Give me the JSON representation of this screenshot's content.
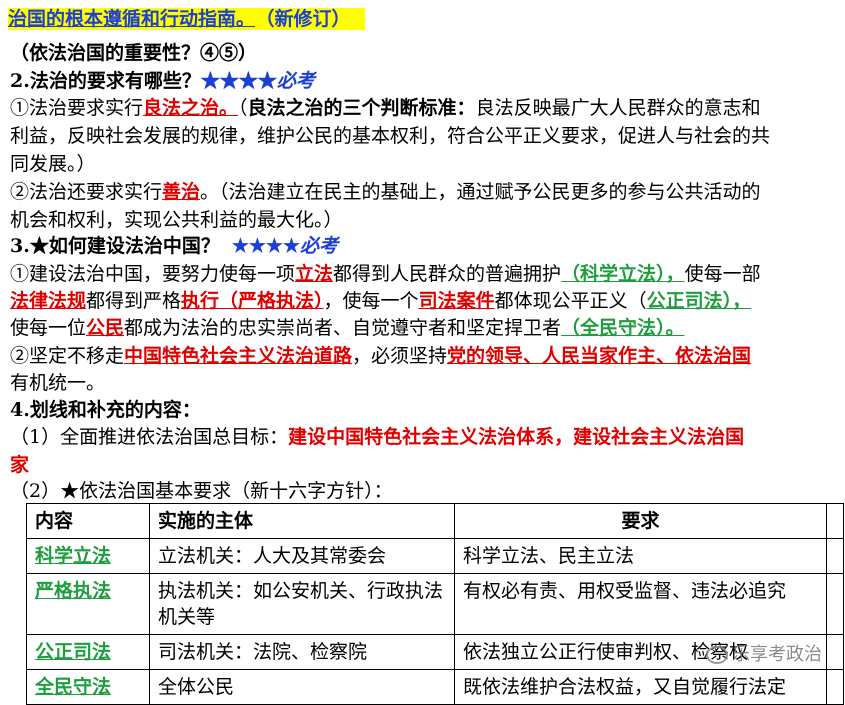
{
  "title": {
    "main": "治国的根本遵循和行动指南。",
    "tag": "（新修订）"
  },
  "q1": "（依法治国的重要性？④⑤）",
  "q2": {
    "heading": "2.法治的要求有哪些？",
    "stars": "★★★★",
    "must": "必考"
  },
  "p1": {
    "a": "①法治要求实行",
    "key": "良法之治。",
    "b": "（",
    "c": "良法之治的三个判断标准：",
    "d": "良法反映最广大人民群众的意志和",
    "line2": "利益，反映社会发展的规律，维护公民的基本权利，符合公平正义要求，促进人与社会的共",
    "line3": "同发展。）"
  },
  "p2": {
    "a": "②法治还要求实行",
    "key": "善治",
    "b": "。（法治建立在民主的基础上，通过赋予公民更多的参与公共活动的",
    "line2": "机会和权利，实现公共利益的最大化。）"
  },
  "q3": {
    "heading": "3.★如何建设法治中国？",
    "stars": "★★★★",
    "must": "必考"
  },
  "p3": {
    "a": "①建设法治中国，要努力使每一项",
    "k1": "立法",
    "b": "都得到人民群众的普遍拥护",
    "g1": "（科学立法），",
    "c": "使每一部",
    "k2": "法律法规",
    "d": "都得到严格",
    "k3": "执行（严格执法）",
    "e": "，使每一个",
    "k4": "司法案件",
    "f": "都体现公平正义（",
    "g2": "公正司法），",
    "g": "使每一位",
    "k5": "公民",
    "h": "都成为法治的忠实崇尚者、自觉遵守者和坚定捍卫者",
    "g3": "（全民守法）。"
  },
  "p4": {
    "a": "②坚定不移走",
    "k1": "中国特色社会主义法治道路",
    "b": "，必须坚持",
    "k2": "党的领导、人民当家作主、依法治国",
    "line2": "有机统一。"
  },
  "q4": "4.划线和补充的内容：",
  "p5": {
    "a": "（1）全面推进依法治国总目标：",
    "k1": "建设中国特色社会主义法治体系，建设社会主义法治国",
    "k2": "家"
  },
  "p6": {
    "a": "（2）★依法治国基本要求（新十六字方针）："
  },
  "table": {
    "headers": [
      "内容",
      "实施的主体",
      "要求"
    ],
    "rows": [
      {
        "c1": "科学立法",
        "c2": "立法机关：人大及其常委会",
        "c3": "科学立法、民主立法"
      },
      {
        "c1": "严格执法",
        "c2": "执法机关：如公安机关、行政执法机关等",
        "c3": "有权必有责、用权受监督、违法必追究"
      },
      {
        "c1": "公正司法",
        "c2": "司法机关：法院、检察院",
        "c3": "依法独立公正行使审判权、检察权"
      },
      {
        "c1": "全民守法",
        "c2": "全体公民",
        "c3": "既依法维护合法权益，又自觉履行法定"
      }
    ]
  },
  "watermark": "乐享考政治"
}
